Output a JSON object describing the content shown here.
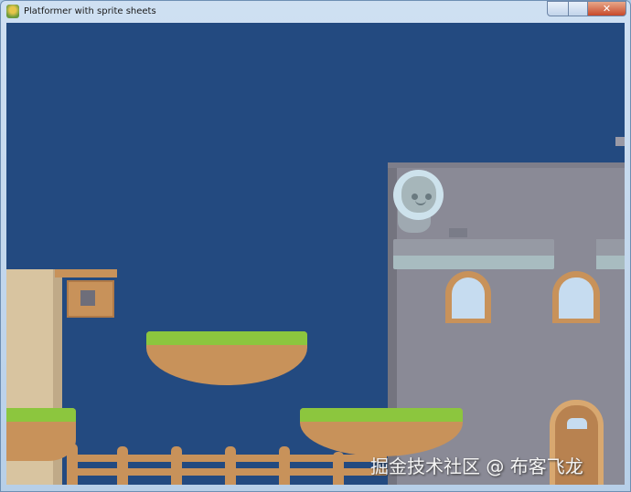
{
  "window": {
    "title": "Platformer with sprite sheets",
    "close_glyph": "✕"
  },
  "watermark": "掘金技术社区 @ 布客飞龙",
  "colors": {
    "sky": "#234a80",
    "grass": "#8cc63e",
    "dirt": "#c8925a",
    "building": "#8a8a96",
    "wall": "#d8c4a0"
  }
}
